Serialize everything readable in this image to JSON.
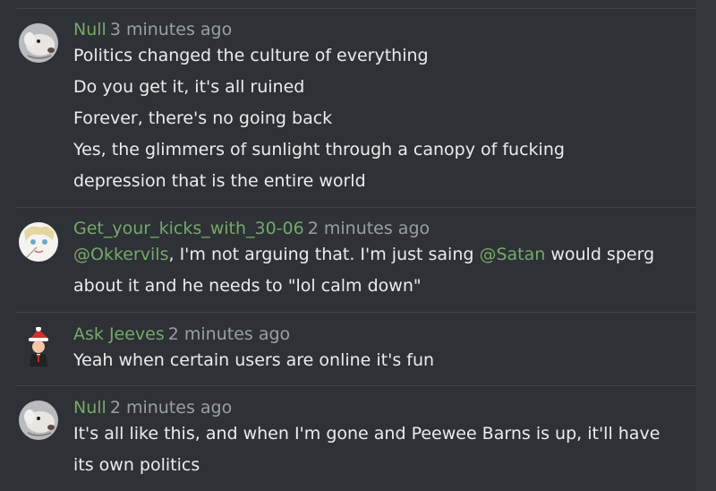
{
  "messages": [
    {
      "author": "Null",
      "time": "3 minutes ago",
      "lines": [
        "Politics changed the culture of everything",
        "Do you get it, it's all ruined",
        "Forever, there's no going back",
        "Yes, the glimmers of sunlight through a canopy of fucking",
        "depression that is the entire world"
      ]
    },
    {
      "author": "Get_your_kicks_with_30-06",
      "time": "2 minutes ago",
      "line1": {
        "mention1": "@Okkervils",
        "text1": ", I'm not arguing that. I'm just saing ",
        "mention2": "@Satan",
        "text2": " would sperg"
      },
      "line2": "about it and he needs to \"lol calm down\""
    },
    {
      "author": "Ask Jeeves",
      "time": "2 minutes ago",
      "lines": [
        "Yeah when certain users are online it's fun"
      ]
    },
    {
      "author": "Null",
      "time": "2 minutes ago",
      "lines": [
        "It's all like this, and when I'm gone and Peewee Barns is up, it'll have",
        "its own politics"
      ]
    }
  ],
  "colors": {
    "background": "#2e3136",
    "username": "#76a96a",
    "timestamp": "#9aa0a6",
    "text": "#ececec",
    "separator": "#42464c"
  },
  "icons": [
    "avatar-null",
    "avatar-get-your-kicks",
    "avatar-ask-jeeves"
  ]
}
